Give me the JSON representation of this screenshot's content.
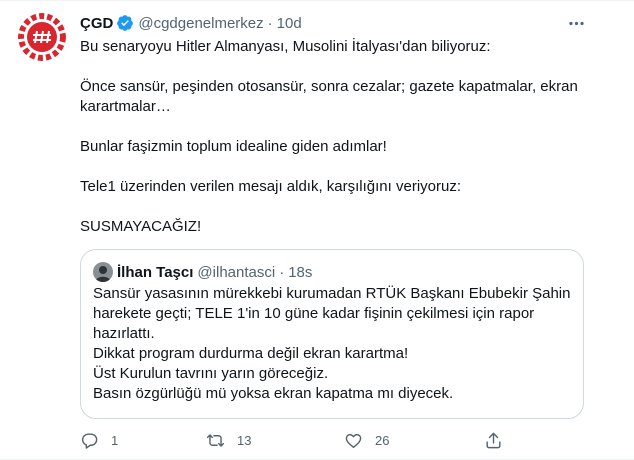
{
  "tweet": {
    "author_name": "ÇGD",
    "handle": "@cgdgenelmerkez",
    "separator": "·",
    "time": "10d",
    "paragraphs": [
      "Bu senaryoyu Hitler Almanyası, Musolini İtalyası'dan biliyoruz:",
      "Önce sansür, peşinden otosansür, sonra cezalar; gazete kapatmalar, ekran\nkarartmalar…",
      "Bunlar faşizmin toplum idealine giden adımlar!",
      "Tele1 üzerinden verilen mesajı aldık, karşılığını veriyoruz:",
      "SUSMAYACAĞIZ!"
    ]
  },
  "quote": {
    "author_name": "İlhan Taşcı",
    "handle": "@ilhantasci",
    "separator": "·",
    "time": "18s",
    "lines": [
      "Sansür yasasının mürekkebi kurumadan RTÜK Başkanı Ebubekir Şahin\nharekete geçti; TELE 1'in 10 güne kadar fişinin çekilmesi için rapor\nhazırlattı.",
      "Dikkat program durdurma değil ekran karartma!",
      "Üst Kurulun tavrını yarın göreceğiz.",
      "Basın özgürlüğü mü yoksa ekran kapatma mı diyecek."
    ]
  },
  "actions": {
    "reply_count": "1",
    "retweet_count": "13",
    "like_count": "26"
  },
  "icons": {
    "verified": "verified-badge-icon",
    "more": "more-options-icon",
    "reply": "reply-icon",
    "retweet": "retweet-icon",
    "like": "like-icon",
    "share": "share-icon"
  },
  "colors": {
    "verified": "#1d9bf0",
    "muted_text": "#536471",
    "border": "#cfd9de",
    "logo_red": "#d7262e"
  }
}
